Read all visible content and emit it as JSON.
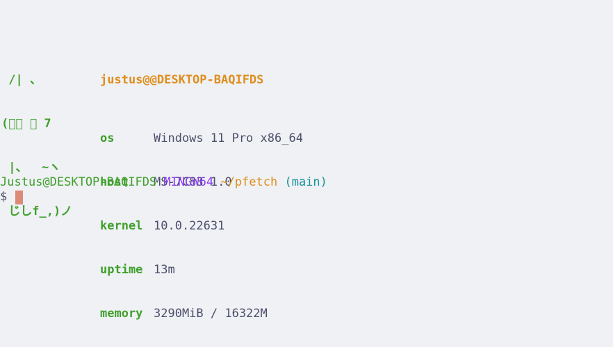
{
  "window": {
    "background": "#eff1f5"
  },
  "pfetch": {
    "ascii_art": [
      " /| 、",
      "(ﾟ､ 。 7",
      " |、  ~ヽ",
      " じしf_,)ノ"
    ],
    "title": "justus@@DESKTOP-BAQIFDS",
    "rows": [
      {
        "key": "os",
        "value": "Windows 11 Pro x86_64"
      },
      {
        "key": "host",
        "value": "MS-7C83 1.0"
      },
      {
        "key": "kernel",
        "value": "10.0.22631"
      },
      {
        "key": "uptime",
        "value": "13m"
      },
      {
        "key": "memory",
        "value": "3290MiB / 16322M"
      }
    ]
  },
  "prompt": {
    "user_host": "Justus@DESKTOP-BAQIFDS",
    "shell": "MINGW64",
    "cwd": "~/pfetch",
    "branch": "(main)",
    "symbol": "$"
  },
  "colors": {
    "green": "#40a02b",
    "orange": "#df8e1d",
    "purple": "#8839ef",
    "teal": "#179299",
    "text": "#4c4f69",
    "cursor": "#dc8a78"
  }
}
